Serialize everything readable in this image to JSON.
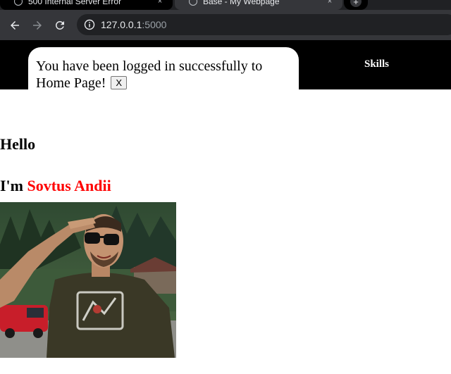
{
  "browser": {
    "tabs": [
      {
        "title": "500 Internal Server Error",
        "active": false
      },
      {
        "title": "Base - My Webpage",
        "active": true
      }
    ],
    "new_tab_label": "+",
    "tab_close_glyph": "×",
    "address": {
      "host": "127.0.0.1",
      "port": ":5000"
    }
  },
  "header": {
    "nav_items": [
      {
        "label": "Skills"
      }
    ]
  },
  "flash": {
    "message": "You have been logged in successfully to Home Page!",
    "close_label": "X"
  },
  "main": {
    "greeting": "Hello",
    "intro_prefix": "I'm ",
    "name": "Sovtus Andii"
  },
  "colors": {
    "header_bg": "#000000",
    "name_accent": "#ff0000",
    "chrome_toolbar": "#35363a",
    "chrome_omnibox": "#202124"
  },
  "icons": {
    "back": "arrow-left-icon",
    "forward": "arrow-right-icon",
    "reload": "reload-icon",
    "site_info": "info-icon"
  }
}
